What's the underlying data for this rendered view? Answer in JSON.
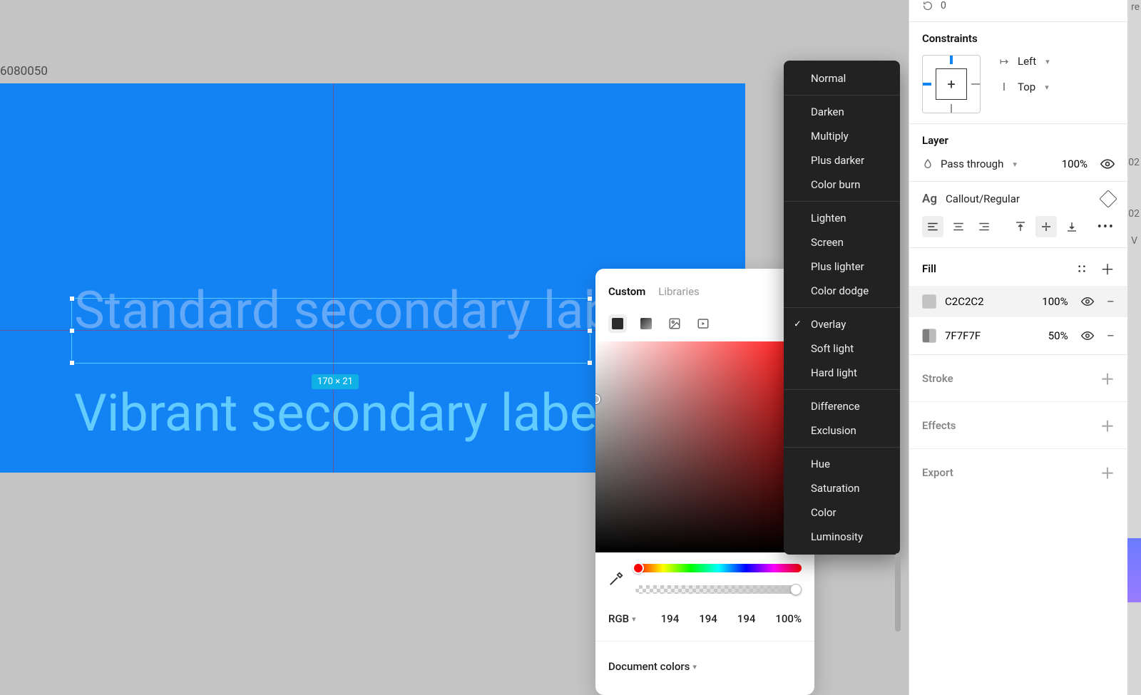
{
  "canvas": {
    "frame_number": "6080050",
    "standard_label": "Standard secondary label",
    "vibrant_label": "Vibrant secondary label",
    "selection_size": "170 × 21"
  },
  "picker": {
    "tabs": {
      "custom": "Custom",
      "libraries": "Libraries"
    },
    "mode_label": "RGB",
    "channels": {
      "r": "194",
      "g": "194",
      "b": "194",
      "a": "100%"
    },
    "doc_colors_label": "Document colors"
  },
  "blend_modes": {
    "selected": "Overlay",
    "groups": [
      [
        "Normal"
      ],
      [
        "Darken",
        "Multiply",
        "Plus darker",
        "Color burn"
      ],
      [
        "Lighten",
        "Screen",
        "Plus lighter",
        "Color dodge"
      ],
      [
        "Overlay",
        "Soft light",
        "Hard light"
      ],
      [
        "Difference",
        "Exclusion"
      ],
      [
        "Hue",
        "Saturation",
        "Color",
        "Luminosity"
      ]
    ]
  },
  "inspector": {
    "rotation_value": "0",
    "constraints": {
      "title": "Constraints",
      "h": "Left",
      "v": "Top"
    },
    "layer": {
      "title": "Layer",
      "mode": "Pass through",
      "opacity": "100%"
    },
    "text": {
      "style": "Callout/Regular"
    },
    "fill": {
      "title": "Fill",
      "rows": [
        {
          "hex": "C2C2C2",
          "opacity": "100%"
        },
        {
          "hex": "7F7F7F",
          "opacity": "50%"
        }
      ]
    },
    "stroke_title": "Stroke",
    "effects_title": "Effects",
    "export_title": "Export"
  },
  "edge": {
    "a": "re",
    "b": "02",
    "c": "02",
    "d": "V"
  }
}
